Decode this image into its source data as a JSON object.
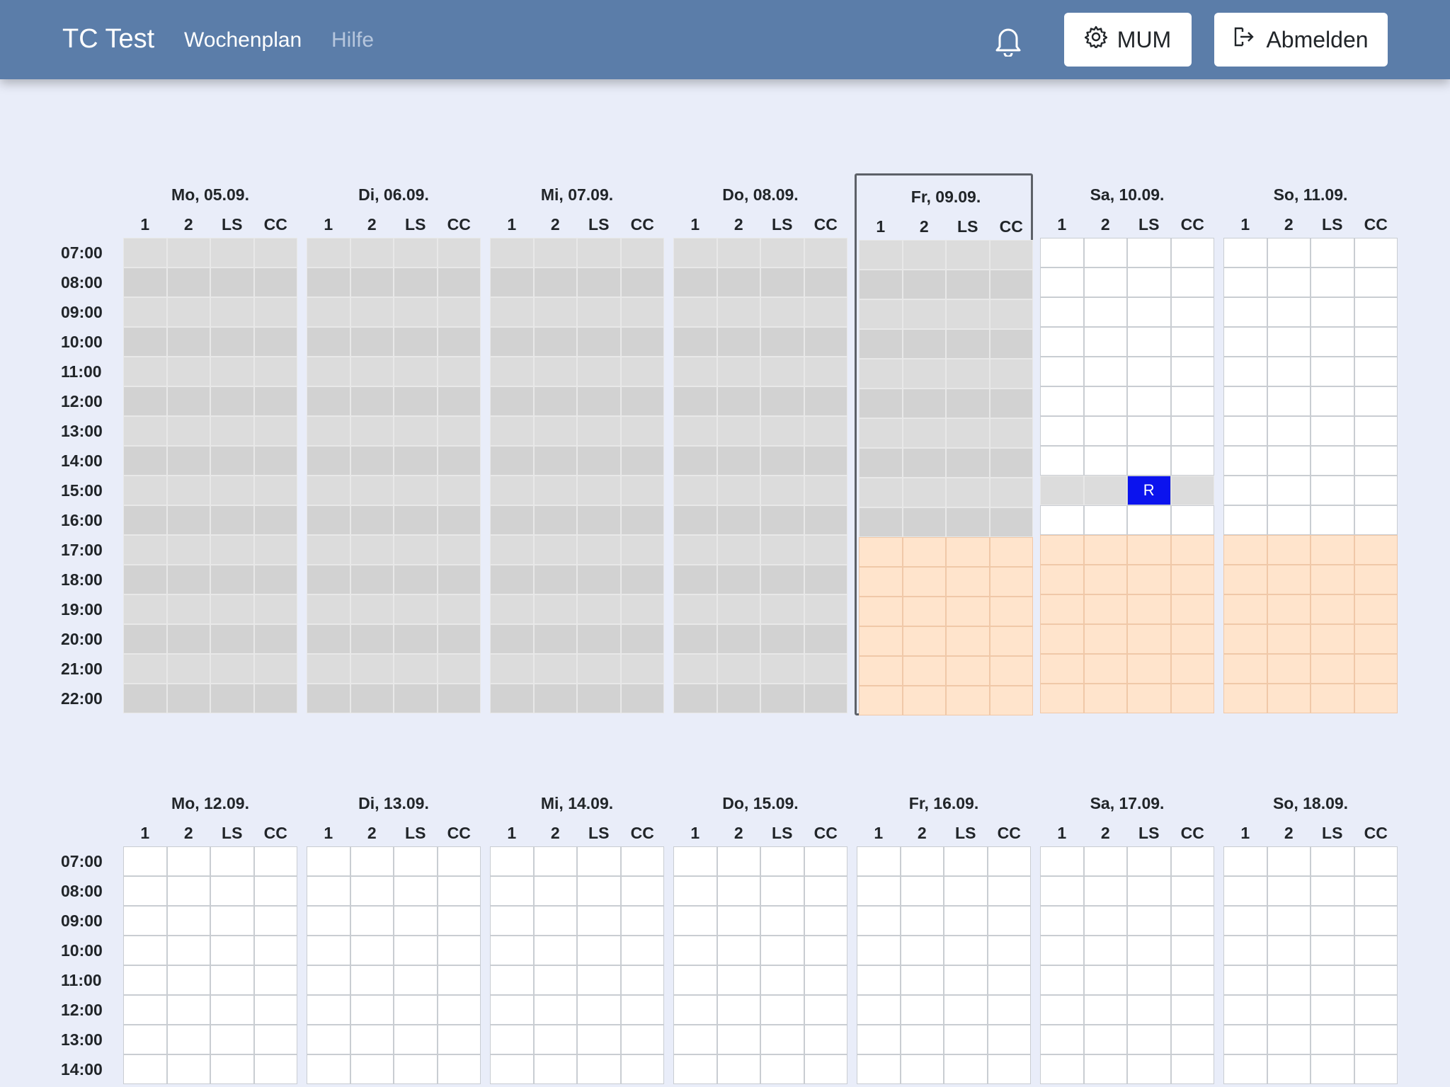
{
  "navbar": {
    "brand": "TC Test",
    "links": [
      "Wochenplan",
      "Hilfe"
    ],
    "settings_label": "MUM",
    "logout_label": "Abmelden"
  },
  "courts": [
    "1",
    "2",
    "LS",
    "CC"
  ],
  "weeks": [
    {
      "times": [
        "07:00",
        "08:00",
        "09:00",
        "10:00",
        "11:00",
        "12:00",
        "13:00",
        "14:00",
        "15:00",
        "16:00",
        "17:00",
        "18:00",
        "19:00",
        "20:00",
        "21:00",
        "22:00"
      ],
      "days": [
        {
          "label": "Mo, 05.09.",
          "status": "past"
        },
        {
          "label": "Di, 06.09.",
          "status": "past"
        },
        {
          "label": "Mi, 07.09.",
          "status": "past"
        },
        {
          "label": "Do, 08.09.",
          "status": "past"
        },
        {
          "label": "Fr, 09.09.",
          "status": "today",
          "past_until": "17:00"
        },
        {
          "label": "Sa, 10.09.",
          "status": "future"
        },
        {
          "label": "So, 11.09.",
          "status": "future"
        }
      ],
      "evening_from": "17:00",
      "blocked_row": {
        "day": "Sa, 10.09.",
        "time": "15:00"
      },
      "bookings": [
        {
          "day": "Sa, 10.09.",
          "time": "15:00",
          "court": "LS",
          "label": "R"
        }
      ]
    },
    {
      "times": [
        "07:00",
        "08:00",
        "09:00",
        "10:00",
        "11:00",
        "12:00",
        "13:00",
        "14:00"
      ],
      "days": [
        {
          "label": "Mo, 12.09.",
          "status": "future"
        },
        {
          "label": "Di, 13.09.",
          "status": "future"
        },
        {
          "label": "Mi, 14.09.",
          "status": "future"
        },
        {
          "label": "Do, 15.09.",
          "status": "future"
        },
        {
          "label": "Fr, 16.09.",
          "status": "future"
        },
        {
          "label": "Sa, 17.09.",
          "status": "future"
        },
        {
          "label": "So, 18.09.",
          "status": "future"
        }
      ],
      "bookings": []
    }
  ],
  "colors": {
    "navbar": "#5b7da9",
    "background": "#e9edf9",
    "past_cell": "#dcdcdc",
    "evening_cell": "#ffe4cc",
    "booking": "#0b13ee"
  },
  "icons": [
    "bell-icon",
    "gear-icon",
    "logout-icon"
  ]
}
